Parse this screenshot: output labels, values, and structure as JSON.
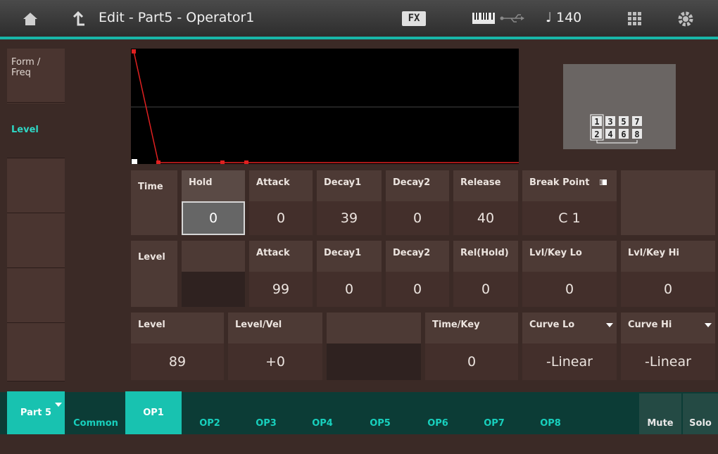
{
  "header": {
    "home_icon": "home-icon",
    "back_icon": "back-arrow-icon",
    "title": "Edit - Part5 - Operator1",
    "fx": "FX",
    "tempo": "♩ 140"
  },
  "left_tabs": [
    {
      "label": "Form /\nFreq"
    },
    {
      "label": "Level"
    }
  ],
  "time_row": {
    "label": "Time",
    "headers": [
      "Hold",
      "Attack",
      "Decay1",
      "Decay2",
      "Release",
      "Break Point"
    ],
    "values": [
      "0",
      "0",
      "39",
      "0",
      "40",
      "C 1"
    ]
  },
  "level_row": {
    "label": "Level",
    "headers": [
      "Attack",
      "Decay1",
      "Decay2",
      "Rel(Hold)",
      "Lvl/Key Lo",
      "Lvl/Key Hi"
    ],
    "values": [
      "99",
      "0",
      "0",
      "0",
      "0",
      "0"
    ]
  },
  "bottom_row": {
    "level_label": "Level",
    "level_value": "89",
    "levelvel_label": "Level/Vel",
    "levelvel_value": "+0",
    "timekey_label": "Time/Key",
    "timekey_value": "0",
    "curvelo_label": "Curve Lo",
    "curvelo_value": "-Linear",
    "curvehi_label": "Curve Hi",
    "curvehi_value": "-Linear"
  },
  "algorithm": {
    "top": [
      "1",
      "3",
      "5",
      "7"
    ],
    "bottom": [
      "2",
      "4",
      "6",
      "8"
    ]
  },
  "bottom_tabs": {
    "part": "Part 5",
    "common": "Common",
    "ops": [
      "OP1",
      "OP2",
      "OP3",
      "OP4",
      "OP5",
      "OP6",
      "OP7",
      "OP8"
    ],
    "mute": "Mute",
    "solo": "Solo"
  },
  "colors": {
    "accent": "#18c2b0",
    "envelope": "#e02020"
  }
}
